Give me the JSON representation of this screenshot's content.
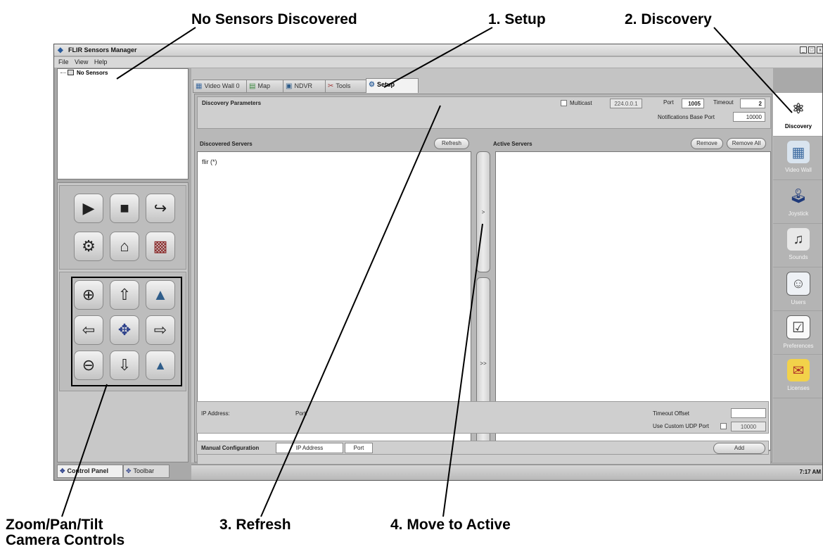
{
  "callouts": {
    "no_sensors": "No Sensors Discovered",
    "setup": "1. Setup",
    "discovery": "2. Discovery",
    "refresh": "3. Refresh",
    "move_active": "4. Move to Active",
    "zoom_line1": "Zoom/Pan/Tilt",
    "zoom_line2": "Camera Controls"
  },
  "window": {
    "title": "FLIR Sensors Manager",
    "menu": [
      "File",
      "View",
      "Help"
    ]
  },
  "tree": {
    "root_label": "No Sensors"
  },
  "tabs": [
    {
      "label": "Video Wall 0",
      "icon": "video-wall-tab-icon",
      "glyph": "▦"
    },
    {
      "label": "Map",
      "icon": "map-tab-icon",
      "glyph": "▤"
    },
    {
      "label": "NDVR",
      "icon": "ndvr-tab-icon",
      "glyph": "▣"
    },
    {
      "label": "Tools",
      "icon": "tools-tab-icon",
      "glyph": "✂"
    },
    {
      "label": "Setup",
      "icon": "setup-tab-icon",
      "glyph": "⚙"
    }
  ],
  "discovery_params": {
    "title": "Discovery Parameters",
    "multicast_label": "Multicast",
    "multicast_address": "224.0.0.1",
    "port_label": "Port",
    "port_value": "1005",
    "timeout_label": "Timeout",
    "timeout_value": "2",
    "notif_label": "Notifications Base Port",
    "notif_value": "10000"
  },
  "discovered": {
    "title": "Discovered Servers",
    "refresh_label": "Refresh",
    "items": [
      "flir (*)"
    ]
  },
  "move": {
    "single": ">",
    "all": ">>"
  },
  "active": {
    "title": "Active Servers",
    "remove_label": "Remove",
    "remove_all_label": "Remove All"
  },
  "details": {
    "ip_label": "IP Address:",
    "port_label": "Port:",
    "timeout_offset_label": "Timeout Offset",
    "custom_udp_label": "Use Custom UDP Port",
    "custom_udp_value": "10000"
  },
  "manual": {
    "title": "Manual Configuration",
    "ip_placeholder": "IP Address",
    "port_placeholder": "Port",
    "add_label": "Add"
  },
  "sidebar": [
    {
      "label": "Discovery",
      "icon": "discovery-icon",
      "glyph": "⚛"
    },
    {
      "label": "Video Wall",
      "icon": "video-wall-icon",
      "glyph": "▦"
    },
    {
      "label": "Joystick",
      "icon": "joystick-icon",
      "glyph": "🕹"
    },
    {
      "label": "Sounds",
      "icon": "sounds-icon",
      "glyph": "♫"
    },
    {
      "label": "Users",
      "icon": "users-icon",
      "glyph": "☺"
    },
    {
      "label": "Preferences",
      "icon": "preferences-icon",
      "glyph": "☑"
    },
    {
      "label": "Licenses",
      "icon": "licenses-icon",
      "glyph": "✉"
    }
  ],
  "control_panel": {
    "playback": [
      {
        "name": "play-icon",
        "glyph": "▶"
      },
      {
        "name": "stop-icon",
        "glyph": "■"
      },
      {
        "name": "redo-icon",
        "glyph": "↪"
      },
      {
        "name": "settings-icon",
        "glyph": "⚙"
      },
      {
        "name": "home-icon",
        "glyph": "⌂"
      },
      {
        "name": "video-icon",
        "glyph": "▩"
      }
    ],
    "ptz": [
      {
        "name": "zoom-in-icon",
        "glyph": "⊕"
      },
      {
        "name": "arrow-up-icon",
        "glyph": "⇧"
      },
      {
        "name": "focus-far-icon",
        "glyph": "▲"
      },
      {
        "name": "arrow-left-icon",
        "glyph": "⇦"
      },
      {
        "name": "joystick-center-icon",
        "glyph": "✥"
      },
      {
        "name": "arrow-right-icon",
        "glyph": "⇨"
      },
      {
        "name": "zoom-out-icon",
        "glyph": "⊖"
      },
      {
        "name": "arrow-down-icon",
        "glyph": "⇩"
      },
      {
        "name": "focus-near-icon",
        "glyph": "▲"
      }
    ]
  },
  "bottom_tabs": [
    {
      "label": "Control Panel",
      "icon": "control-panel-tab-icon",
      "glyph": "✥"
    },
    {
      "label": "Toolbar",
      "icon": "toolbar-tab-icon",
      "glyph": "✥"
    }
  ],
  "status": {
    "time": "7:17 AM"
  }
}
